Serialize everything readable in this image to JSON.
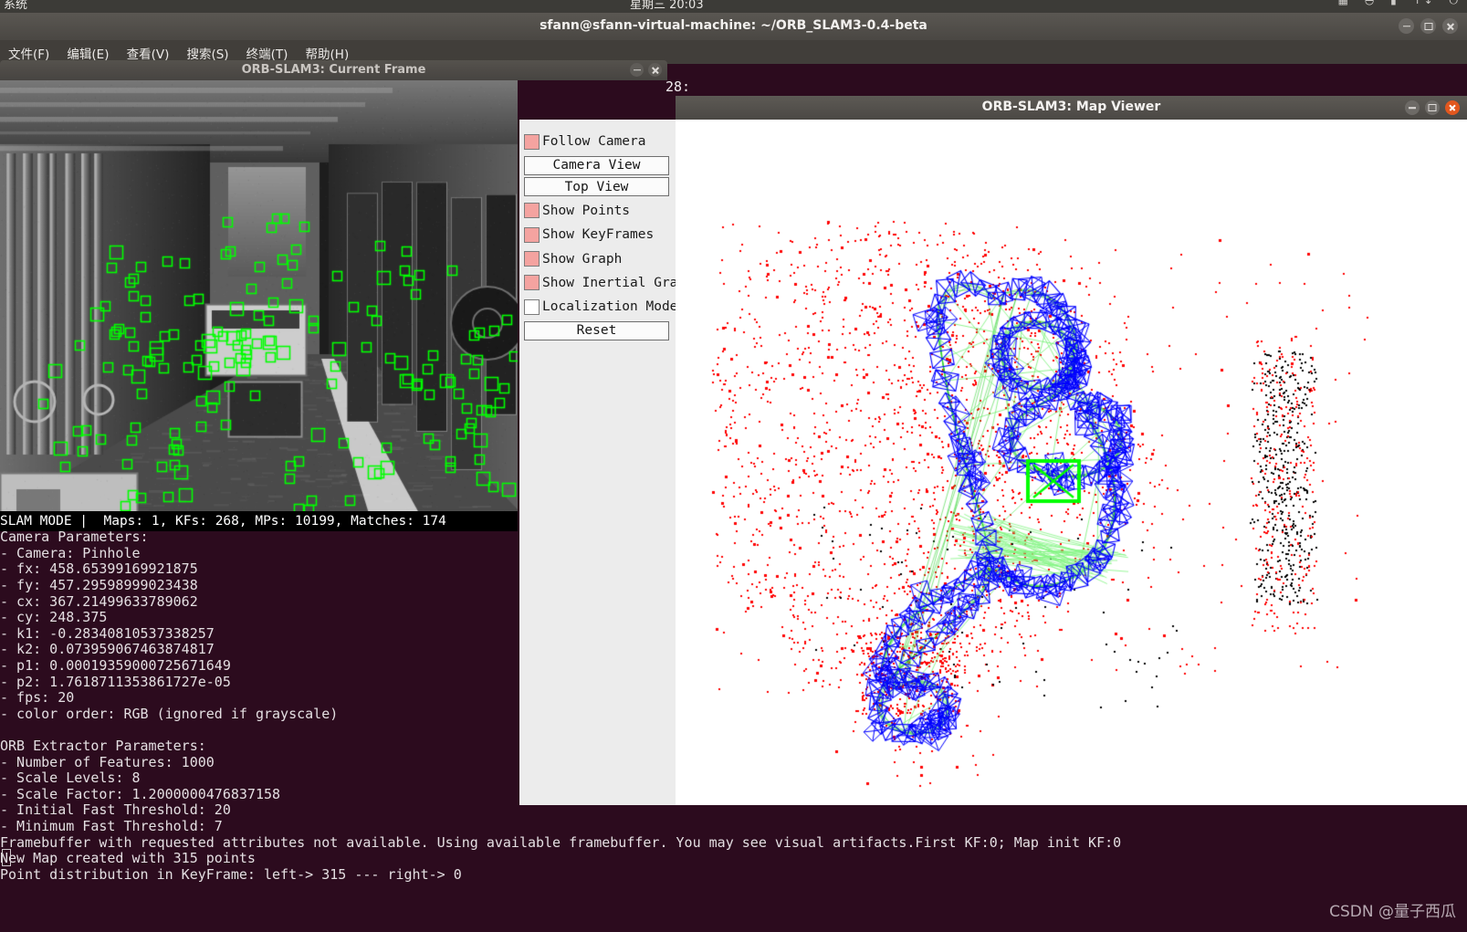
{
  "system_bar": {
    "left_label": "系统",
    "center_label": "星期三 20:03",
    "tray_icons": [
      "keyboard-layout-icon",
      "volume-icon",
      "battery-icon",
      "network-icon",
      "power-icon"
    ]
  },
  "terminal": {
    "title": "sfann@sfann-virtual-machine: ~/ORB_SLAM3-0.4-beta",
    "menu": [
      {
        "label": "文件(F)",
        "name": "menu-file"
      },
      {
        "label": "编辑(E)",
        "name": "menu-edit"
      },
      {
        "label": "查看(V)",
        "name": "menu-view"
      },
      {
        "label": "搜索(S)",
        "name": "menu-search"
      },
      {
        "label": "终端(T)",
        "name": "menu-terminal"
      },
      {
        "label": "帮助(H)",
        "name": "menu-help"
      }
    ],
    "partial_text": "28:",
    "lines": [
      "",
      "",
      "",
      "",
      "",
      "",
      "",
      "",
      "",
      "",
      "",
      "",
      "",
      "",
      "",
      "",
      "",
      "",
      "",
      "",
      "",
      "",
      "",
      "",
      "",
      "",
      "",
      "",
      "",
      "Camera Parameters:",
      "- Camera: Pinhole",
      "- fx: 458.65399169921875",
      "- fy: 457.29598999023438",
      "- cx: 367.21499633789062",
      "- cy: 248.375",
      "- k1: -0.28340810537338257",
      "- k2: 0.073959067463874817",
      "- p1: 0.00019359000725671649",
      "- p2: 1.7618711353861727e-05",
      "- fps: 20",
      "- color order: RGB (ignored if grayscale)",
      "",
      "ORB Extractor Parameters:",
      "- Number of Features: 1000",
      "- Scale Levels: 8",
      "- Scale Factor: 1.2000000476837158",
      "- Initial Fast Threshold: 20",
      "- Minimum Fast Threshold: 7",
      "Framebuffer with requested attributes not available. Using available framebuffer. You may see visual artifacts.First KF:0; Map init KF:0",
      "New Map created with 315 points",
      "Point distribution in KeyFrame: left-> 315 --- right-> 0"
    ],
    "watermark": "CSDN @量子西瓜"
  },
  "current_frame_window": {
    "title": "ORB-SLAM3: Current Frame",
    "window_buttons": [
      "minimize-icon",
      "close-icon"
    ],
    "status_bar": "SLAM MODE |  Maps: 1, KFs: 268, MPs: 10199, Matches: 174",
    "status_values": {
      "mode": "SLAM MODE",
      "maps": 1,
      "kfs": 268,
      "mps": 10199,
      "matches": 174
    },
    "feature_color": "#00ff00",
    "feature_count": 174
  },
  "map_viewer_window": {
    "title": "ORB-SLAM3: Map Viewer",
    "window_buttons": [
      "minimize-icon",
      "maximize-icon",
      "close-icon"
    ],
    "panel": {
      "items": [
        {
          "type": "checkbox",
          "label": "Follow Camera",
          "checked": true,
          "name": "follow-camera-checkbox"
        },
        {
          "type": "button",
          "label": "Camera View",
          "name": "camera-view-button"
        },
        {
          "type": "button",
          "label": "Top View",
          "name": "top-view-button"
        },
        {
          "type": "checkbox",
          "label": "Show Points",
          "checked": true,
          "name": "show-points-checkbox"
        },
        {
          "type": "checkbox",
          "label": "Show KeyFrames",
          "checked": true,
          "name": "show-keyframes-checkbox"
        },
        {
          "type": "checkbox",
          "label": "Show Graph",
          "checked": true,
          "name": "show-graph-checkbox"
        },
        {
          "type": "checkbox",
          "label": "Show Inertial Graph",
          "checked": true,
          "name": "show-inertial-graph-checkbox"
        },
        {
          "type": "checkbox",
          "label": "Localization Mode",
          "checked": false,
          "name": "localization-mode-checkbox"
        },
        {
          "type": "button",
          "label": "Reset",
          "name": "reset-button"
        }
      ]
    },
    "colors": {
      "map_points_current": "#ff0000",
      "map_points_reference": "#000000",
      "keyframes": "#0000ff",
      "covisibility_graph": "#33cc33",
      "current_camera": "#00ff00",
      "background": "#ffffff"
    }
  }
}
